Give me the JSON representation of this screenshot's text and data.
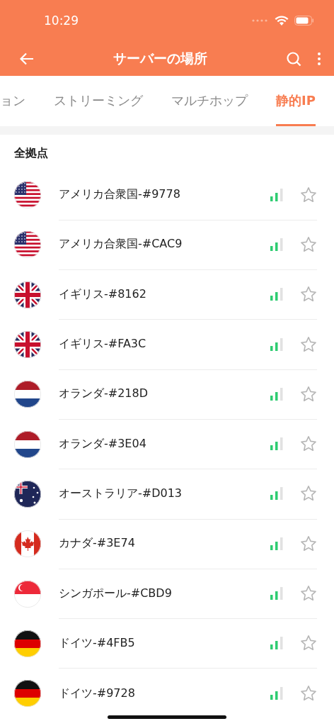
{
  "status_bar": {
    "time": "10:29"
  },
  "app_bar": {
    "title": "サーバーの場所"
  },
  "tabs": [
    {
      "label": "ョン",
      "selected": false
    },
    {
      "label": "ストリーミング",
      "selected": false
    },
    {
      "label": "マルチホップ",
      "selected": false
    },
    {
      "label": "静的IP",
      "selected": true
    }
  ],
  "section": {
    "title": "全拠点"
  },
  "servers": [
    {
      "name": "アメリカ合衆国-#9778",
      "kind": "usa",
      "favorite": false
    },
    {
      "name": "アメリカ合衆国-#CAC9",
      "kind": "usa",
      "favorite": false
    },
    {
      "name": "イギリス-#8162",
      "kind": "uk",
      "favorite": false
    },
    {
      "name": "イギリス-#FA3C",
      "kind": "uk",
      "favorite": false
    },
    {
      "name": "オランダ-#218D",
      "kind": "netherlands",
      "favorite": false
    },
    {
      "name": "オランダ-#3E04",
      "kind": "netherlands",
      "favorite": false
    },
    {
      "name": "オーストラリア-#D013",
      "kind": "australia",
      "favorite": false
    },
    {
      "name": "カナダ-#3E74",
      "kind": "canada",
      "favorite": false
    },
    {
      "name": "シンガポール-#CBD9",
      "kind": "singapore",
      "favorite": false
    },
    {
      "name": "ドイツ-#4FB5",
      "kind": "germany",
      "favorite": false
    },
    {
      "name": "ドイツ-#9728",
      "kind": "germany",
      "favorite": false
    }
  ]
}
